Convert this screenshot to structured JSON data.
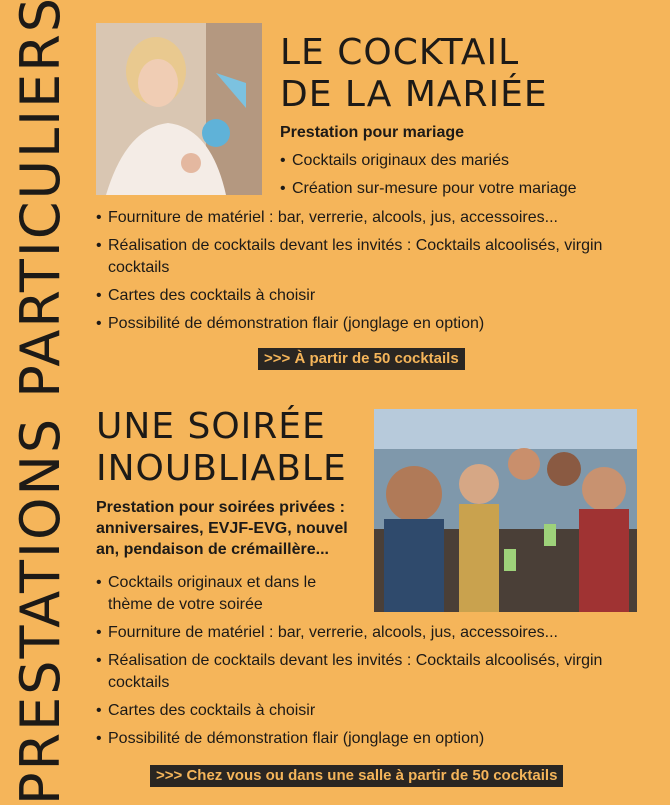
{
  "side_title": "PRESTATIONS PARTICULIERS",
  "section1": {
    "title_line1": "LE COCKTAIL",
    "title_line2": "DE LA MARIÉE",
    "subtitle": "Prestation pour mariage",
    "bullets_top": [
      "Cocktails originaux des mariés",
      "Création sur-mesure pour votre mariage"
    ],
    "bullets": [
      "Fourniture de matériel : bar, verrerie, alcools, jus, accessoires...",
      "Réalisation de cocktails devant les invités : Cocktails alcoolisés, virgin cocktails",
      "Cartes des cocktails à choisir",
      "Possibilité de démonstration flair (jonglage en option)"
    ],
    "cta": ">>> À partir de 50 cocktails"
  },
  "section2": {
    "title_line1": "UNE SOIRÉE",
    "title_line2": "INOUBLIABLE",
    "subtitle": "Prestation pour soirées privées : anniversaires, EVJF-EVG, nouvel an, pendaison de crémaillère...",
    "bullets_top": [
      "Cocktails originaux et dans le thème de votre soirée"
    ],
    "bullets": [
      "Fourniture de matériel : bar, verrerie, alcools, jus, accessoires...",
      "Réalisation de cocktails devant les invités : Cocktails alcoolisés, virgin cocktails",
      "Cartes des cocktails à choisir",
      "Possibilité de démonstration flair (jonglage en option)"
    ],
    "cta": ">>> Chez vous ou dans une salle à partir de 50 cocktails"
  }
}
